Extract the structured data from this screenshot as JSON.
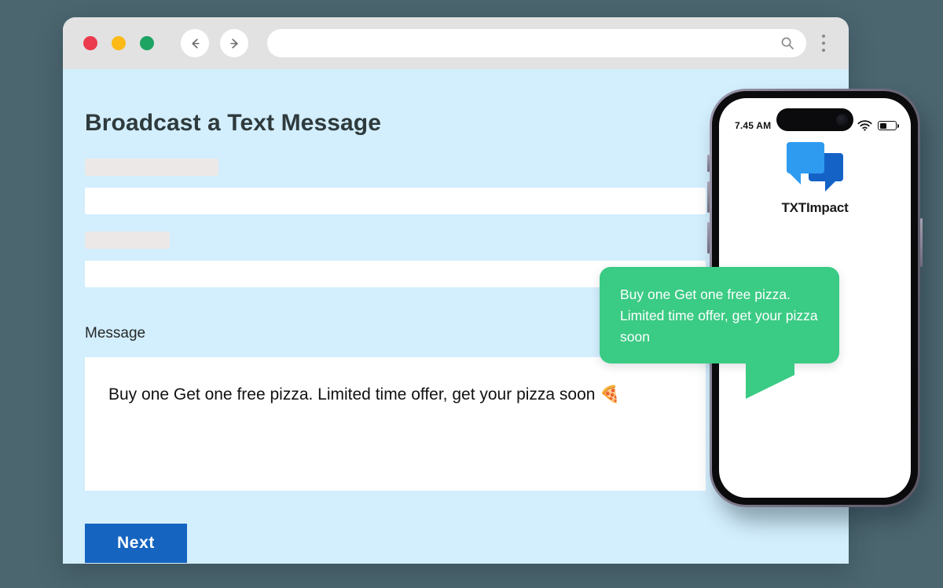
{
  "background_color": "#4C6670",
  "browser": {
    "traffic_lights": [
      "close",
      "minimize",
      "maximize"
    ],
    "back_label": "Back",
    "forward_label": "Forward",
    "address_value": "",
    "address_placeholder": "",
    "search_icon": "search-icon",
    "menu_icon": "kebab-menu-icon",
    "chrome_color": "#E2E2E2",
    "page_background": "#D3EEFD"
  },
  "page": {
    "title": "Broadcast a Text Message",
    "fields": [
      {
        "label_placeholder": "",
        "value": ""
      },
      {
        "label_placeholder": "",
        "value": ""
      }
    ],
    "message": {
      "label": "Message",
      "value": "Buy one Get one free pizza. Limited time offer, get your pizza soon 🍕",
      "emoji": "🍕"
    },
    "next_label": "Next",
    "next_color": "#1464C0"
  },
  "phone": {
    "status": {
      "time": "7.45 AM",
      "wifi_icon": "wifi-icon",
      "battery_icon": "battery-icon"
    },
    "app": {
      "name": "TXTImpact",
      "logo_icon": "chat-bubbles-icon",
      "bubble_front_color": "#2E9BF0",
      "bubble_back_color": "#1462C6"
    }
  },
  "sms_bubble": {
    "text": "Buy one Get one free pizza. Limited time offer, get your pizza soon",
    "color": "#3ACB84",
    "text_color": "#FFFFFF"
  }
}
